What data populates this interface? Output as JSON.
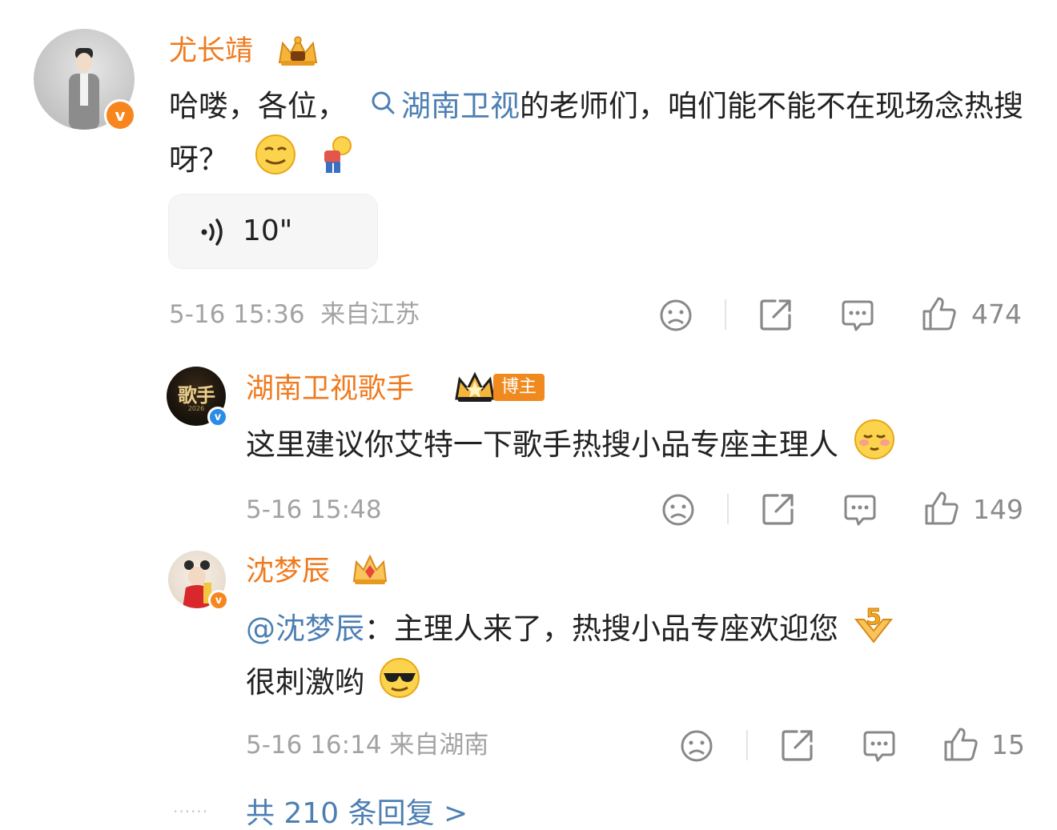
{
  "main_comment": {
    "username": "尤长靖",
    "text_before_link": "哈喽，各位，",
    "link_text": "湖南卫视",
    "text_after_link": "的老师们，咱们能不能不在现场念热搜呀？",
    "voice_duration": "10\"",
    "date": "5-16 15:36",
    "location": "来自江苏",
    "like_count": "474"
  },
  "replies": [
    {
      "username": "湖南卫视歌手",
      "role_badge": "博主",
      "avatar_text": "歌手",
      "avatar_subtext": "2026",
      "text": "这里建议你艾特一下歌手热搜小品专座主理人",
      "date": "5-16 15:48",
      "like_count": "149"
    },
    {
      "username": "沈梦辰",
      "mention": "@沈梦辰",
      "text_line1": "：主理人来了，热搜小品专座欢迎您",
      "text_line2": "很刺激哟",
      "date": "5-16 16:14",
      "location": "来自湖南",
      "like_count": "15"
    }
  ],
  "reply_summary": {
    "dots": "······",
    "label": "共 210 条回复 >"
  },
  "colors": {
    "username": "#f07a1d",
    "link": "#4d7fb3",
    "meta": "#a3a3a3",
    "vip_orange": "#f7861f",
    "verified_blue": "#2b8ce6"
  },
  "icons": [
    "search-icon",
    "dislike-face-icon",
    "share-icon",
    "comment-icon",
    "thumbs-up-icon",
    "crown-icon",
    "voice-icon",
    "verified-badge-icon"
  ]
}
